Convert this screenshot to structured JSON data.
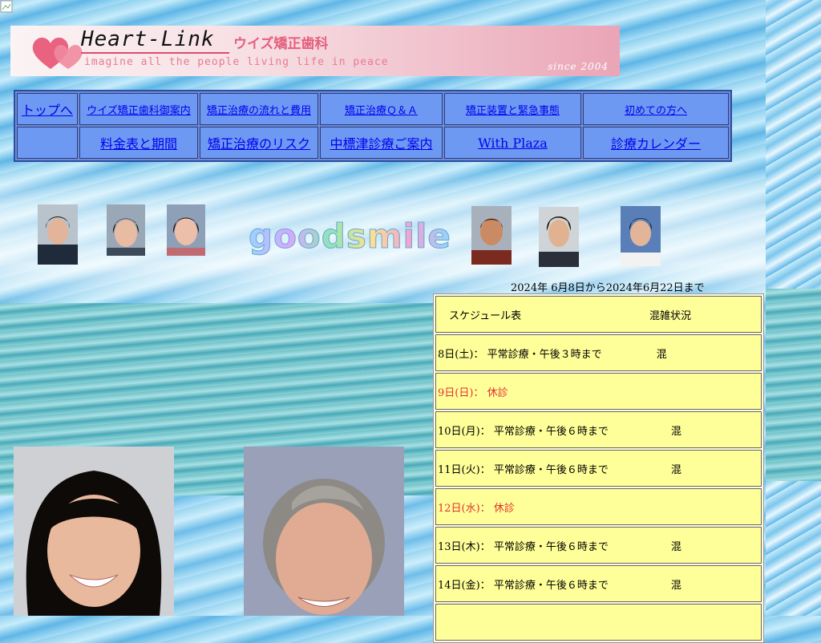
{
  "banner": {
    "brand": "Heart-Link",
    "clinic": "ウイズ矯正歯科",
    "tagline": "imagine all the people living life in peace",
    "since": "since 2004"
  },
  "nav": {
    "row1": [
      "トップへ",
      "ウイズ矯正歯科御案内",
      "矯正治療の流れと費用",
      "矯正治療Ｑ＆Ａ",
      "矯正装置と緊急事態",
      "初めての方へ"
    ],
    "row2": [
      "",
      "料金表と期間",
      "矯正治療のリスク",
      "中標津診療ご案内",
      "With Plaza",
      "診療カレンダー"
    ]
  },
  "goodsmile": "goodsmile",
  "schedule": {
    "date_range": "2024年 6月8日から2024年6月22日まで",
    "header_left": "スケジュール表",
    "header_right": "混雑状況",
    "rows": [
      {
        "day": "8日(土)：",
        "text": "平常診療・午後３時まで",
        "crowd": "混",
        "holiday": false
      },
      {
        "day": "9日(日)：",
        "text": "休診",
        "crowd": "",
        "holiday": true
      },
      {
        "day": "10日(月)：",
        "text": "平常診療・午後６時まで",
        "crowd": "混",
        "holiday": false
      },
      {
        "day": "11日(火)：",
        "text": "平常診療・午後６時まで",
        "crowd": "混",
        "holiday": false
      },
      {
        "day": "12日(水)：",
        "text": "休診",
        "crowd": "",
        "holiday": true
      },
      {
        "day": "13日(木)：",
        "text": "平常診療・午後６時まで",
        "crowd": "混",
        "holiday": false
      },
      {
        "day": "14日(金)：",
        "text": "平常診療・午後６時まで",
        "crowd": "混",
        "holiday": false
      }
    ]
  },
  "colors": {
    "nav_bg": "#6e99f2",
    "schedule_bg": "#ffff99",
    "holiday": "#e23030",
    "banner_pink": "#eaa5b6"
  }
}
